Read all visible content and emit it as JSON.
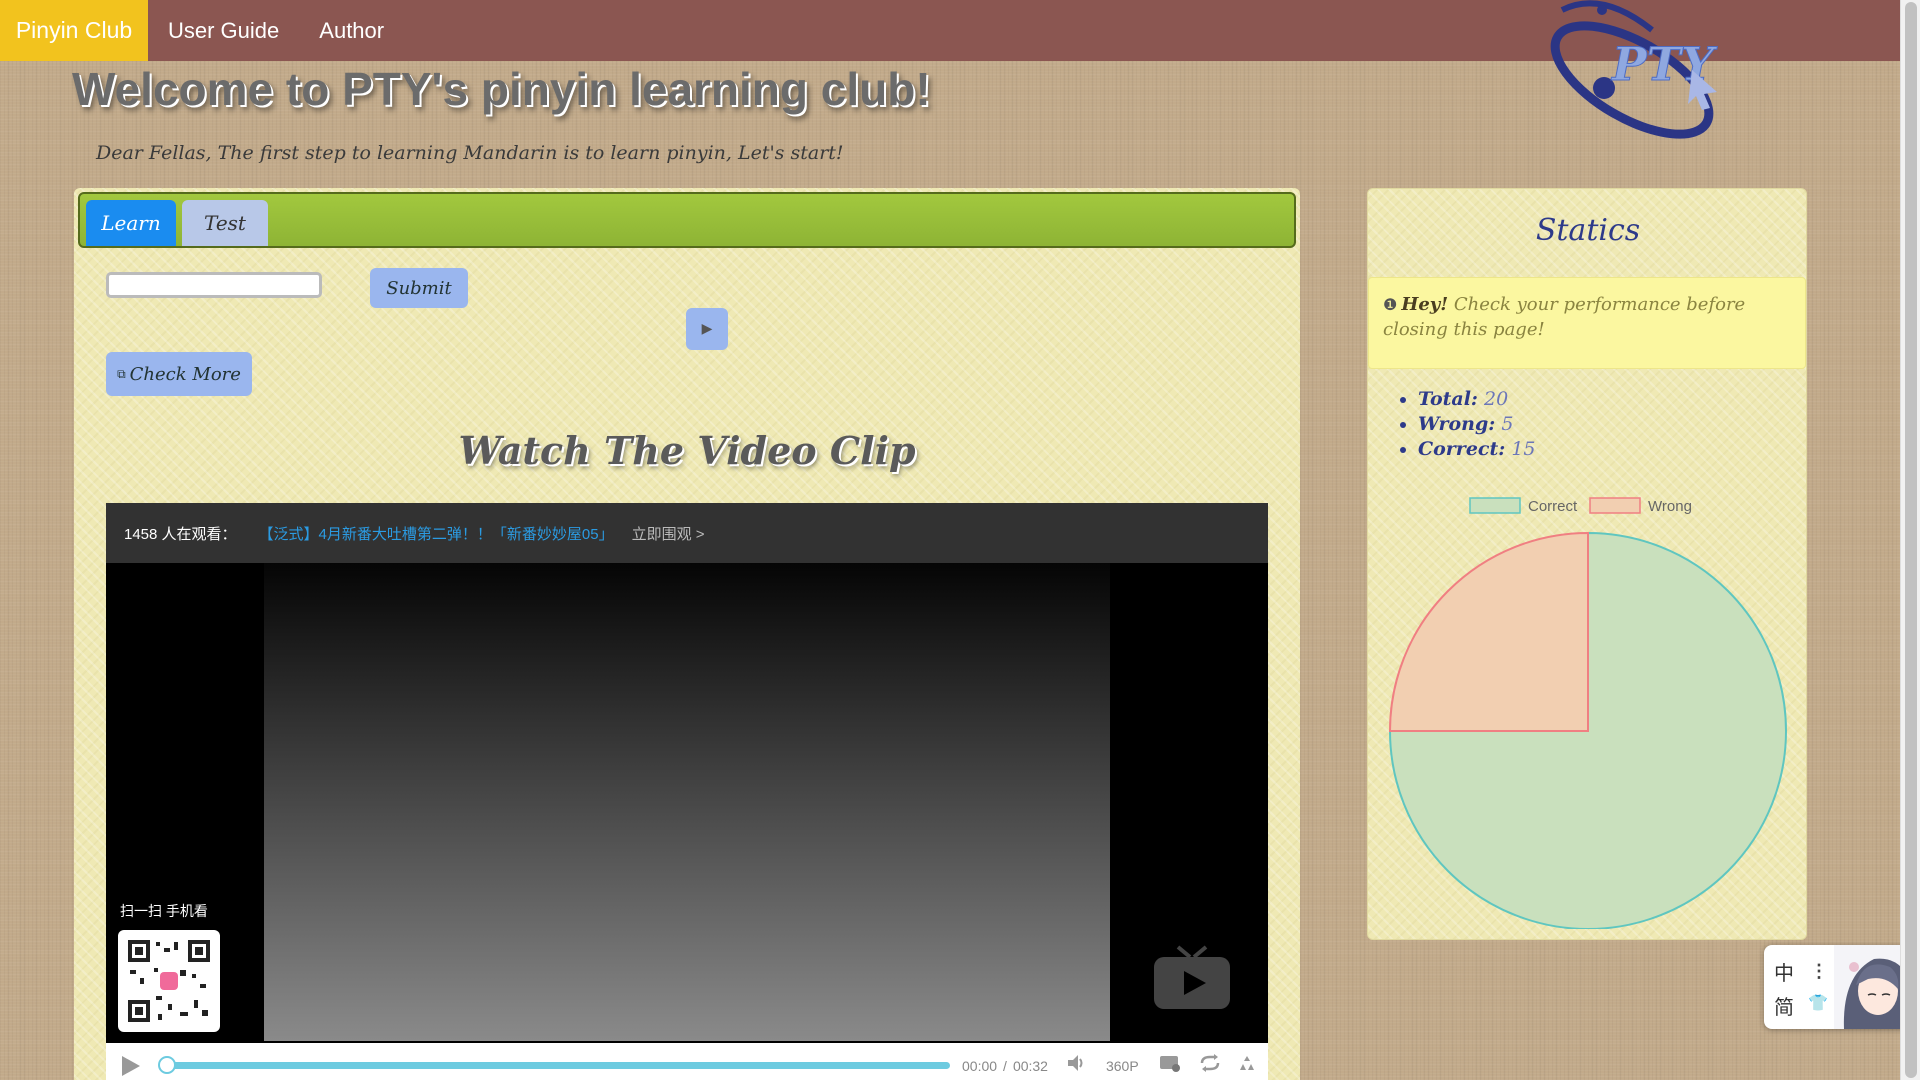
{
  "nav": {
    "brand": "Pinyin Club",
    "links": [
      "User Guide",
      "Author"
    ]
  },
  "logo_text": "PTY",
  "header": {
    "title": "Welcome to PTY's pinyin learning club!",
    "intro": "Dear Fellas, The first step to learning Mandarin is to learn pinyin, Let's start!"
  },
  "tabs": {
    "learn": "Learn",
    "test": "Test"
  },
  "learn": {
    "answer_value": "",
    "submit_label": "Submit",
    "play_label": "▶",
    "check_more_icon": "⧉",
    "check_more_label": "Check More",
    "video_heading": "Watch The Video Clip"
  },
  "player": {
    "viewers": "1458 人在观看：",
    "video_link": "【泛式】4月新番大吐槽第二弹！！「新番妙妙屋05」",
    "watch_now": "立即围观 >",
    "qr_label": "扫一扫 手机看",
    "current_time": "00:00",
    "time_sep": "/",
    "duration": "00:32",
    "quality": "360P",
    "progress": 0.0
  },
  "stats": {
    "title": "Statics",
    "alert_hey": "Hey!",
    "alert_text": " Check your performance before closing this page!",
    "total_label": "Total:",
    "total_value": "20",
    "wrong_label": "Wrong:",
    "wrong_value": "5",
    "correct_label": "Correct:",
    "correct_value": "15"
  },
  "chart_data": {
    "type": "pie",
    "categories": [
      "Correct",
      "Wrong"
    ],
    "values": [
      15,
      5
    ],
    "colors": {
      "Correct": {
        "fill": "#c9e0bd",
        "stroke": "#5fc6c0"
      },
      "Wrong": {
        "fill": "#f2cfb1",
        "stroke": "#f07f82"
      }
    },
    "legend_position": "top"
  },
  "lang_widget": {
    "zh": "中",
    "jian": "简"
  }
}
